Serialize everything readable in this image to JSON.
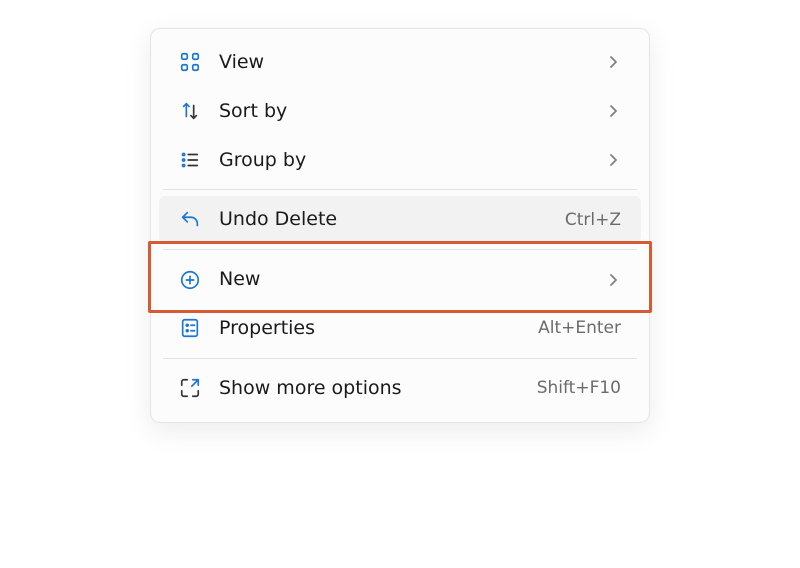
{
  "menu": {
    "items": [
      {
        "id": "view",
        "label": "View",
        "icon": "view",
        "submenu": true
      },
      {
        "id": "sort",
        "label": "Sort by",
        "icon": "sort",
        "submenu": true
      },
      {
        "id": "group",
        "label": "Group by",
        "icon": "group",
        "submenu": true
      },
      {
        "id": "undo",
        "label": "Undo Delete",
        "icon": "undo",
        "shortcut": "Ctrl+Z",
        "highlighted": true
      },
      {
        "id": "new",
        "label": "New",
        "icon": "new",
        "submenu": true
      },
      {
        "id": "properties",
        "label": "Properties",
        "icon": "properties",
        "shortcut": "Alt+Enter"
      },
      {
        "id": "more",
        "label": "Show more options",
        "icon": "more",
        "shortcut": "Shift+F10"
      }
    ]
  },
  "highlight_color": "#d65a33",
  "accent_color": "#1976d2"
}
